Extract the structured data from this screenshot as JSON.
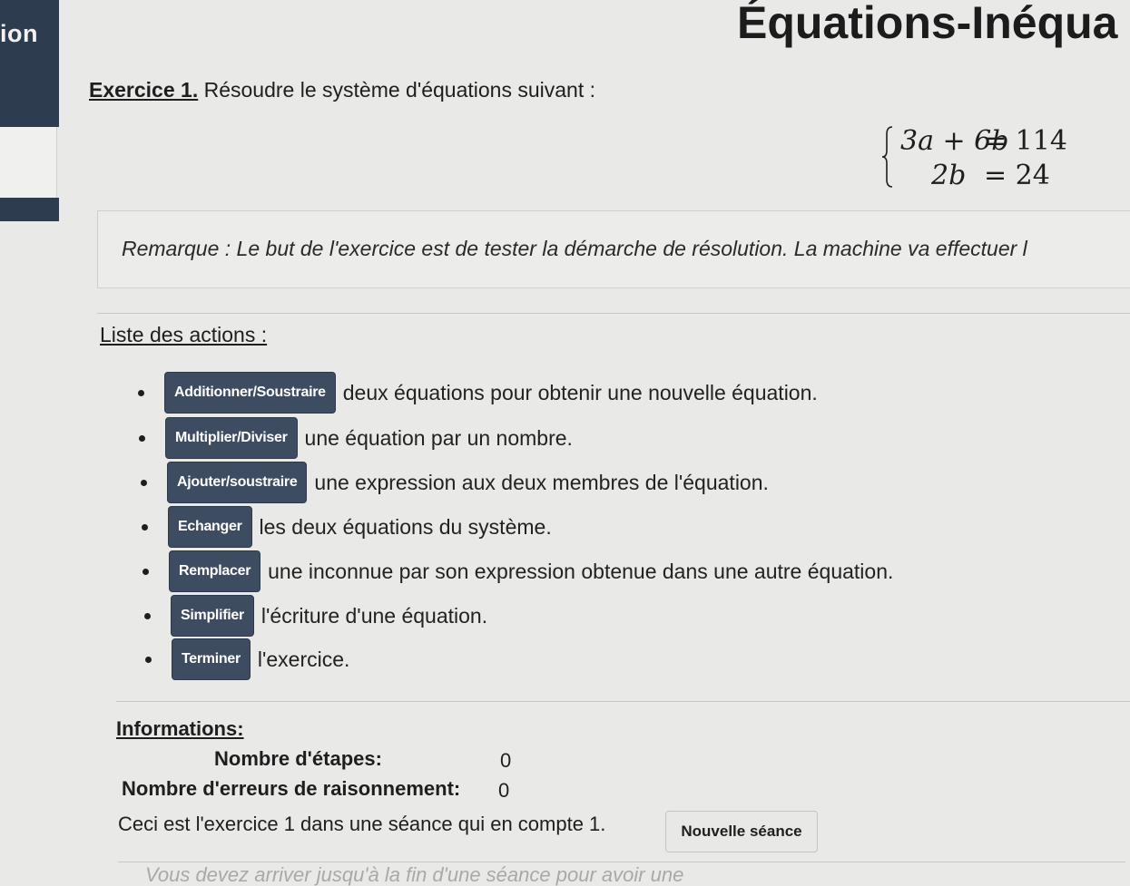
{
  "sidebar": {
    "label": "ion"
  },
  "header": {
    "title": "Équations-Inéqua"
  },
  "exercise": {
    "label": "Exercice 1.",
    "statement": " Résoudre le système d'équations suivant :",
    "system": {
      "eq1_lhs": "3a + 6b",
      "eq1_rhs": "= 114",
      "eq2_lhs": "2b",
      "eq2_rhs": "= 24"
    }
  },
  "remark": {
    "text": "Remarque : Le but de l'exercice est de tester la démarche de résolution. La machine va effectuer l"
  },
  "actions": {
    "title": "Liste des actions :",
    "items": [
      {
        "button": "Additionner/Soustraire",
        "description": "deux équations pour obtenir une nouvelle équation."
      },
      {
        "button": "Multiplier/Diviser",
        "description": "une équation par un nombre."
      },
      {
        "button": "Ajouter/soustraire",
        "description": "une expression aux deux membres de l'équation."
      },
      {
        "button": "Echanger",
        "description": "les deux équations du système."
      },
      {
        "button": "Remplacer",
        "description": "une inconnue par son expression obtenue dans une autre équation."
      },
      {
        "button": "Simplifier",
        "description": "l'écriture d'une équation."
      },
      {
        "button": "Terminer",
        "description": "l'exercice."
      }
    ]
  },
  "info": {
    "title": "Informations:",
    "steps_label": "Nombre d'étapes:",
    "steps_value": "0",
    "errors_label": "Nombre d'erreurs de raisonnement:",
    "errors_value": "0"
  },
  "session": {
    "text": "Ceci est l'exercice 1 dans une séance qui en compte 1.",
    "new_session_label": "Nouvelle séance"
  },
  "footer": {
    "text": "Vous devez arriver jusqu'à la fin d'une séance pour avoir une"
  },
  "colors": {
    "action_button": "#3d4c61",
    "sidebar": "#2e3c4f",
    "background": "#e9e9e7"
  }
}
